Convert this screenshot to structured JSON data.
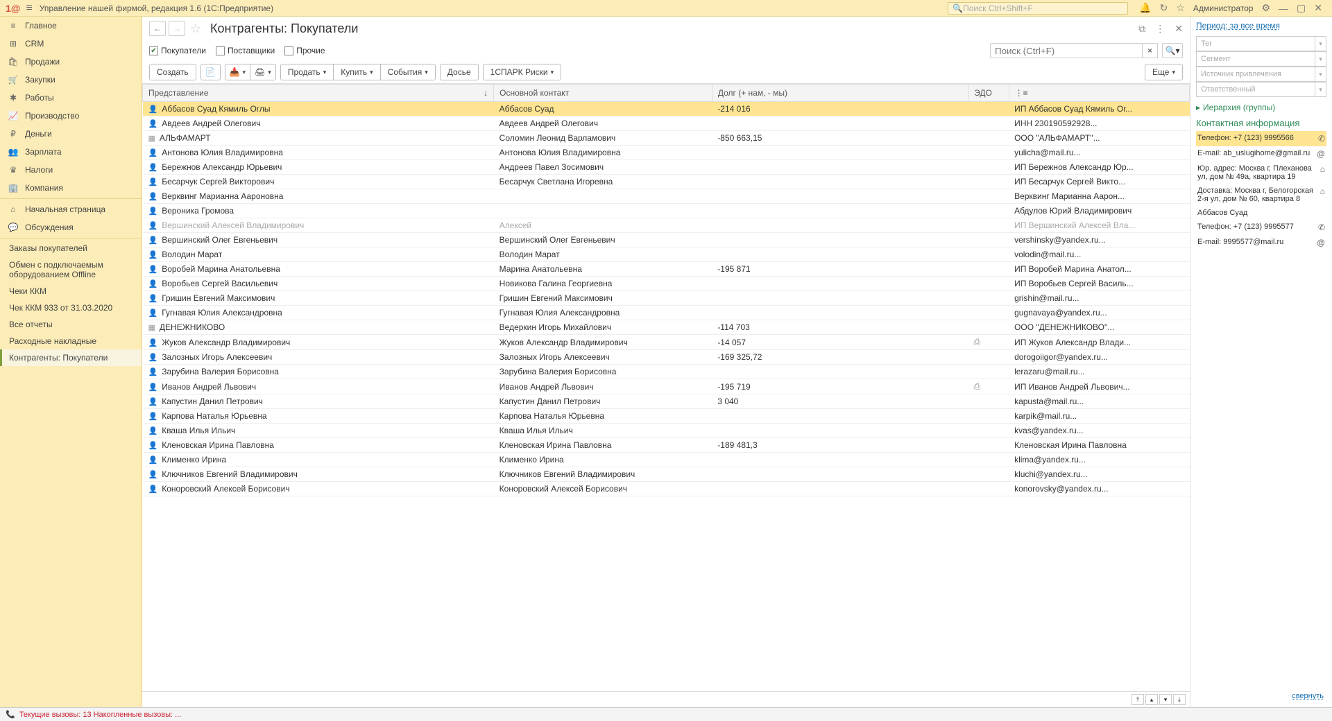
{
  "titlebar": {
    "app": "1@",
    "title": "Управление нашей фирмой, редакция 1.6  (1С:Предприятие)",
    "search_placeholder": "Поиск Ctrl+Shift+F",
    "admin": "Администратор"
  },
  "sidebar": {
    "main": [
      {
        "icon": "≡",
        "label": "Главное"
      },
      {
        "icon": "⊞",
        "label": "CRM"
      },
      {
        "icon": "🛍",
        "label": "Продажи"
      },
      {
        "icon": "🛒",
        "label": "Закупки"
      },
      {
        "icon": "✱",
        "label": "Работы"
      },
      {
        "icon": "📈",
        "label": "Производство"
      },
      {
        "icon": "₽",
        "label": "Деньги"
      },
      {
        "icon": "👥",
        "label": "Зарплата"
      },
      {
        "icon": "♛",
        "label": "Налоги"
      },
      {
        "icon": "🏢",
        "label": "Компания"
      }
    ],
    "secondary": [
      {
        "icon": "⌂",
        "label": "Начальная страница"
      },
      {
        "icon": "💬",
        "label": "Обсуждения"
      }
    ],
    "recent": [
      "Заказы покупателей",
      "Обмен с подключаемым оборудованием Offline",
      "Чеки ККМ",
      "Чек ККМ 933 от 31.03.2020",
      "Все отчеты",
      "Расходные накладные",
      "Контрагенты: Покупатели"
    ]
  },
  "page": {
    "title": "Контрагенты: Покупатели",
    "filters": {
      "buyers": "Покупатели",
      "suppliers": "Поставщики",
      "others": "Прочие"
    },
    "search_placeholder": "Поиск (Ctrl+F)",
    "toolbar": {
      "create": "Создать",
      "sell": "Продать",
      "buy": "Купить",
      "events": "События",
      "dossier": "Досье",
      "spark": "1СПАРК Риски",
      "more": "Еще"
    },
    "columns": {
      "rep": "Представление",
      "contact": "Основной контакт",
      "debt": "Долг (+ нам, - мы)",
      "edo": "ЭДО",
      "info": "⋮≡"
    },
    "rows": [
      {
        "icon": "👤",
        "rep": "Аббасов Суад Кямиль Оглы",
        "contact": "Аббасов Суад",
        "debt": "-214 016",
        "edo": "",
        "info": "ИП Аббасов Суад Кямиль Ог...",
        "selected": true
      },
      {
        "icon": "👤",
        "rep": "Авдеев Андрей Олегович",
        "contact": "Авдеев Андрей Олегович",
        "debt": "",
        "edo": "",
        "info": "ИНН 230190592928..."
      },
      {
        "icon": "▦",
        "rep": "АЛЬФАМАРТ",
        "contact": "Соломин Леонид Варламович",
        "debt": "-850 663,15",
        "edo": "",
        "info": "ООО \"АЛЬФАМАРТ\"..."
      },
      {
        "icon": "👤",
        "rep": "Антонова Юлия Владимировна",
        "contact": "Антонова Юлия Владимировна",
        "debt": "",
        "edo": "",
        "info": "yulicha@mail.ru..."
      },
      {
        "icon": "👤",
        "rep": "Бережнов Александр Юрьевич",
        "contact": "Андреев Павел Зосимович",
        "debt": "",
        "edo": "",
        "info": "ИП Бережнов Александр Юр..."
      },
      {
        "icon": "👤",
        "rep": "Бесарчук Сергей Викторович",
        "contact": "Бесарчук Светлана Игоревна",
        "debt": "",
        "edo": "",
        "info": "ИП Бесарчук Сергей Викто..."
      },
      {
        "icon": "👤",
        "rep": "Верквинг Марианна Аароновна",
        "contact": "",
        "debt": "",
        "edo": "",
        "info": "Верквинг Марианна Аарон..."
      },
      {
        "icon": "👤",
        "rep": "Вероника Громова",
        "contact": "",
        "debt": "",
        "edo": "",
        "info": "Абдулов Юрий Владимирович"
      },
      {
        "icon": "👤",
        "rep": "Вершинский Алексей Владимирович",
        "contact": "Алексей",
        "debt": "",
        "edo": "",
        "info": "ИП Вершинский Алексей Вла...",
        "dimmed": true
      },
      {
        "icon": "👤",
        "rep": "Вершинский Олег Евгеньевич",
        "contact": "Вершинский Олег Евгеньевич",
        "debt": "",
        "edo": "",
        "info": "vershinsky@yandex.ru..."
      },
      {
        "icon": "👤",
        "rep": "Володин Марат",
        "contact": "Володин Марат",
        "debt": "",
        "edo": "",
        "info": "volodin@mail.ru..."
      },
      {
        "icon": "👤",
        "rep": "Воробей Марина Анатольевна",
        "contact": "Марина Анатольевна",
        "debt": "-195 871",
        "edo": "",
        "info": "ИП Воробей Марина Анатол..."
      },
      {
        "icon": "👤",
        "rep": "Воробьев Сергей Васильевич",
        "contact": "Новикова Галина Георгиевна",
        "debt": "",
        "edo": "",
        "info": "ИП Воробьев Сергей Василь..."
      },
      {
        "icon": "👤",
        "rep": "Гришин Евгений Максимович",
        "contact": "Гришин Евгений Максимович",
        "debt": "",
        "edo": "",
        "info": "grishin@mail.ru..."
      },
      {
        "icon": "👤",
        "rep": "Гугнавая Юлия Александровна",
        "contact": "Гугнавая Юлия Александровна",
        "debt": "",
        "edo": "",
        "info": "gugnavaya@yandex.ru..."
      },
      {
        "icon": "▦",
        "rep": "ДЕНЕЖНИКОВО",
        "contact": "Ведеркин Игорь Михайлович",
        "debt": "-114 703",
        "edo": "",
        "info": "ООО \"ДЕНЕЖНИКОВО\"..."
      },
      {
        "icon": "👤",
        "rep": "Жуков Александр Владимирович",
        "contact": "Жуков Александр Владимирович",
        "debt": "-14 057",
        "edo": "⎙",
        "info": "ИП Жуков Александр Влади..."
      },
      {
        "icon": "👤",
        "rep": "Залозных Игорь Алексеевич",
        "contact": "Залозных Игорь Алексеевич",
        "debt": "-169 325,72",
        "edo": "",
        "info": "dorogoiigor@yandex.ru..."
      },
      {
        "icon": "👤",
        "rep": "Зарубина Валерия Борисовна",
        "contact": "Зарубина Валерия Борисовна",
        "debt": "",
        "edo": "",
        "info": "lerazaru@mail.ru..."
      },
      {
        "icon": "👤",
        "rep": "Иванов Андрей Львович",
        "contact": "Иванов Андрей Львович",
        "debt": "-195 719",
        "edo": "⎙",
        "info": "ИП Иванов Андрей Львович..."
      },
      {
        "icon": "👤",
        "rep": "Капустин Данил Петрович",
        "contact": "Капустин Данил Петрович",
        "debt": "3 040",
        "edo": "",
        "info": "kapusta@mail.ru..."
      },
      {
        "icon": "👤",
        "rep": "Карпова Наталья Юрьевна",
        "contact": "Карпова Наталья Юрьевна",
        "debt": "",
        "edo": "",
        "info": "karpik@mail.ru..."
      },
      {
        "icon": "👤",
        "rep": "Кваша Илья Ильич",
        "contact": "Кваша Илья Ильич",
        "debt": "",
        "edo": "",
        "info": "kvas@yandex.ru..."
      },
      {
        "icon": "👤",
        "rep": "Кленовская Ирина Павловна",
        "contact": "Кленовская Ирина Павловна",
        "debt": "-189 481,3",
        "edo": "",
        "info": "Кленовская Ирина Павловна"
      },
      {
        "icon": "👤",
        "rep": "Клименко Ирина",
        "contact": "Клименко Ирина",
        "debt": "",
        "edo": "",
        "info": "klima@yandex.ru..."
      },
      {
        "icon": "👤",
        "rep": "Ключников Евгений Владимирович",
        "contact": "Ключников Евгений Владимирович",
        "debt": "",
        "edo": "",
        "info": "kluchi@yandex.ru..."
      },
      {
        "icon": "👤",
        "rep": "Коноровский Алексей Борисович",
        "contact": "Коноровский Алексей Борисович",
        "debt": "",
        "edo": "",
        "info": "konorovsky@yandex.ru..."
      }
    ]
  },
  "rightpanel": {
    "period": "Период: за все время",
    "selects": [
      "Тег",
      "Сегмент",
      "Источник привлечения",
      "Ответственный"
    ],
    "hierarchy": "Иерархия (группы)",
    "contact_title": "Контактная информация",
    "items": [
      {
        "label": "Телефон: +7 (123) 9995566",
        "icon": "✆",
        "hl": true
      },
      {
        "label": "E-mail: ab_uslugihome@gmail.ru",
        "icon": "@"
      },
      {
        "label": "Юр. адрес: Москва г, Плеханова ул, дом № 49а, квартира 19",
        "icon": "⌂"
      },
      {
        "label": "Доставка: Москва г, Белогорская 2-я ул, дом № 60, квартира 8",
        "icon": "⌂"
      },
      {
        "label": "Аббасов Суад",
        "icon": ""
      },
      {
        "label": "Телефон: +7 (123) 9995577",
        "icon": "✆"
      },
      {
        "label": "E-mail: 9995577@mail.ru",
        "icon": "@"
      }
    ],
    "collapse": "свернуть"
  },
  "statusbar": {
    "text": "Текущие вызовы: 13   Накопленные вызовы: ..."
  }
}
